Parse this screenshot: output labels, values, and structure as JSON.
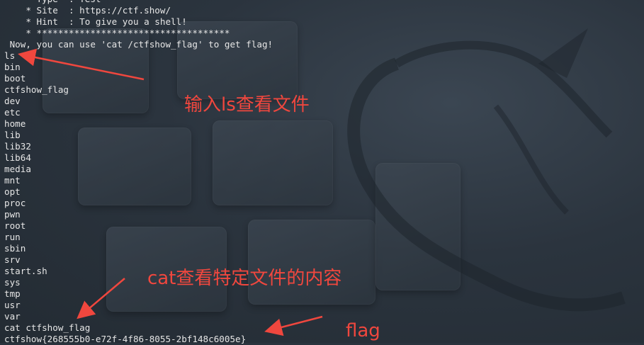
{
  "terminal": {
    "lines": [
      "    * Type  : Test",
      "    * Site  : https://ctf.show/",
      "    * Hint  : To give you a shell!",
      "    * ************************************",
      " Now, you can use 'cat /ctfshow_flag' to get flag!",
      "ls",
      "bin",
      "boot",
      "ctfshow_flag",
      "dev",
      "etc",
      "home",
      "lib",
      "lib32",
      "lib64",
      "media",
      "mnt",
      "opt",
      "proc",
      "pwn",
      "root",
      "run",
      "sbin",
      "srv",
      "start.sh",
      "sys",
      "tmp",
      "usr",
      "var",
      "cat ctfshow_flag",
      "ctfshow{268555b0-e72f-4f86-8055-2bf148c6005e}"
    ]
  },
  "annotations": {
    "ls_note": "输入ls查看文件",
    "cat_note": "cat查看特定文件的内容",
    "flag_note": "flag"
  },
  "colors": {
    "annotation": "#f0473e",
    "terminal_text": "#e6e6e6",
    "background": "#2a333d"
  }
}
